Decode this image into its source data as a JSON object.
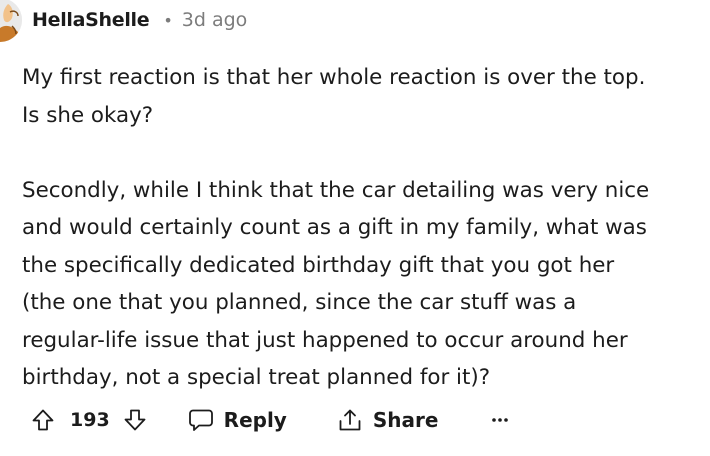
{
  "comment": {
    "author": "HellaShelle",
    "separator": "•",
    "timestamp": "3d ago",
    "paragraphs": [
      {
        "lines": [
          "My first reaction is that her whole reaction is over the top.",
          "Is she okay?"
        ]
      },
      {
        "lines": [
          "Secondly, while I think that the car detailing was very nice",
          "and would certainly count as a gift in my family, what was",
          "the specifically dedicated birthday gift that you got her",
          "(the one that you planned, since the car stuff was a",
          "regular-life issue that just happened to occur around her",
          "birthday, not a special treat planned for it)?"
        ]
      }
    ],
    "score": "193",
    "actions": {
      "reply": "Reply",
      "share": "Share"
    }
  },
  "icons": {
    "avatar": "avatar",
    "upvote": "arrow-up-icon",
    "downvote": "arrow-down-icon",
    "reply": "speech-bubble-icon",
    "share": "share-icon",
    "more": "ellipsis-icon"
  },
  "colors": {
    "text": "#1c1c1c",
    "muted": "#7c7c7c",
    "avatar_accent": "#c87a2a"
  }
}
